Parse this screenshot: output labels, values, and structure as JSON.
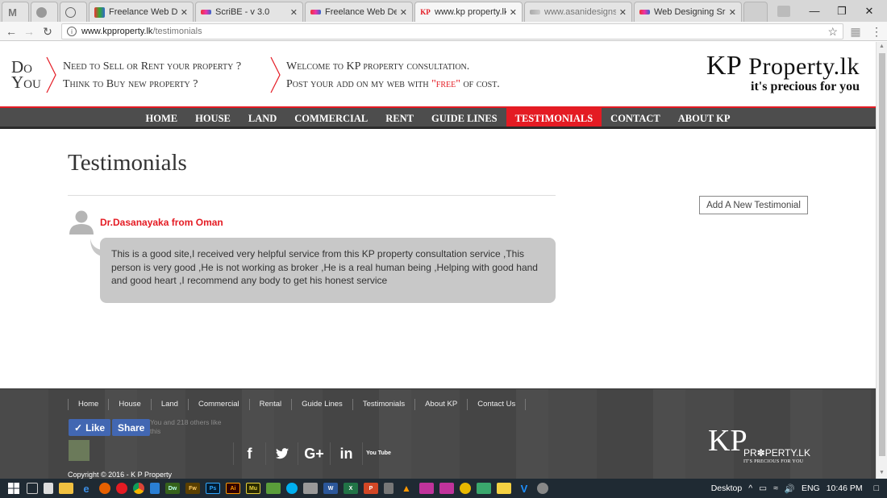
{
  "browser": {
    "tabs": [
      {
        "label": "",
        "kind": "inactive"
      },
      {
        "label": "",
        "kind": "inactive"
      },
      {
        "label": "",
        "kind": "inactive"
      },
      {
        "label": "Freelance Web Desig",
        "kind": "inactive"
      },
      {
        "label": "ScriBE - v 3.0",
        "kind": "inactive"
      },
      {
        "label": "Freelance Web Desig",
        "kind": "inactive"
      },
      {
        "label": "www.kp property.lk",
        "kind": "active"
      },
      {
        "label": "www.asanidesigns.c",
        "kind": "inactive"
      },
      {
        "label": "Web Designing Sri L",
        "kind": "inactive"
      }
    ],
    "tab_close": "✕",
    "url_host": "www.kpproperty.lk",
    "url_path": "/testimonials",
    "favicon_kp": "KP"
  },
  "header": {
    "do": "Do",
    "you": "You",
    "line1": "Need to Sell or Rent your property ?",
    "line2": "Think to Buy new property ?",
    "line3": "Welcome to KP property consultation.",
    "line4_a": "Post your add on my web with ",
    "line4_free": "\"free\"",
    "line4_b": " of cost.",
    "brand_kp": "KP",
    "brand_rest": " Property.lk",
    "brand_tag": "it's precious for you"
  },
  "nav": [
    "HOME",
    "HOUSE",
    "LAND",
    "COMMERCIAL",
    "RENT",
    "GUIDE LINES",
    "TESTIMONIALS",
    "CONTACT",
    "ABOUT KP"
  ],
  "nav_active": "TESTIMONIALS",
  "content": {
    "title": "Testimonials",
    "add_button": "Add A New Testimonial",
    "testimonial": {
      "author": "Dr.Dasanayaka from Oman",
      "text": "This is a good site,I received very helpful service from this KP property consultation service ,This person is very good ,He is not working as broker ,He is a real human being ,Helping with good hand and good heart ,I recommend any body to get his honest service"
    }
  },
  "footer": {
    "links": [
      "Home",
      "House",
      "Land",
      "Commercial",
      "Rental",
      "Guide Lines",
      "Testimonials",
      "About KP",
      "Contact Us"
    ],
    "like": "Like",
    "share": "Share",
    "like_text": "You and 218 others like this",
    "social": [
      "f",
      "t",
      "G+",
      "in",
      "You Tube"
    ],
    "copyright": "Copyright © 2016 - K P Property",
    "logo_kp": "KP",
    "logo_text": "PR✽PERTY.LK",
    "logo_tag": "IT'S PRECIOUS FOR YOU"
  },
  "taskbar": {
    "desktop": "Desktop",
    "lang": "ENG",
    "time": "10:46 PM"
  },
  "colors": {
    "accent": "#e41b23",
    "nav": "#4d4d4d",
    "facebook": "#4267b2"
  }
}
